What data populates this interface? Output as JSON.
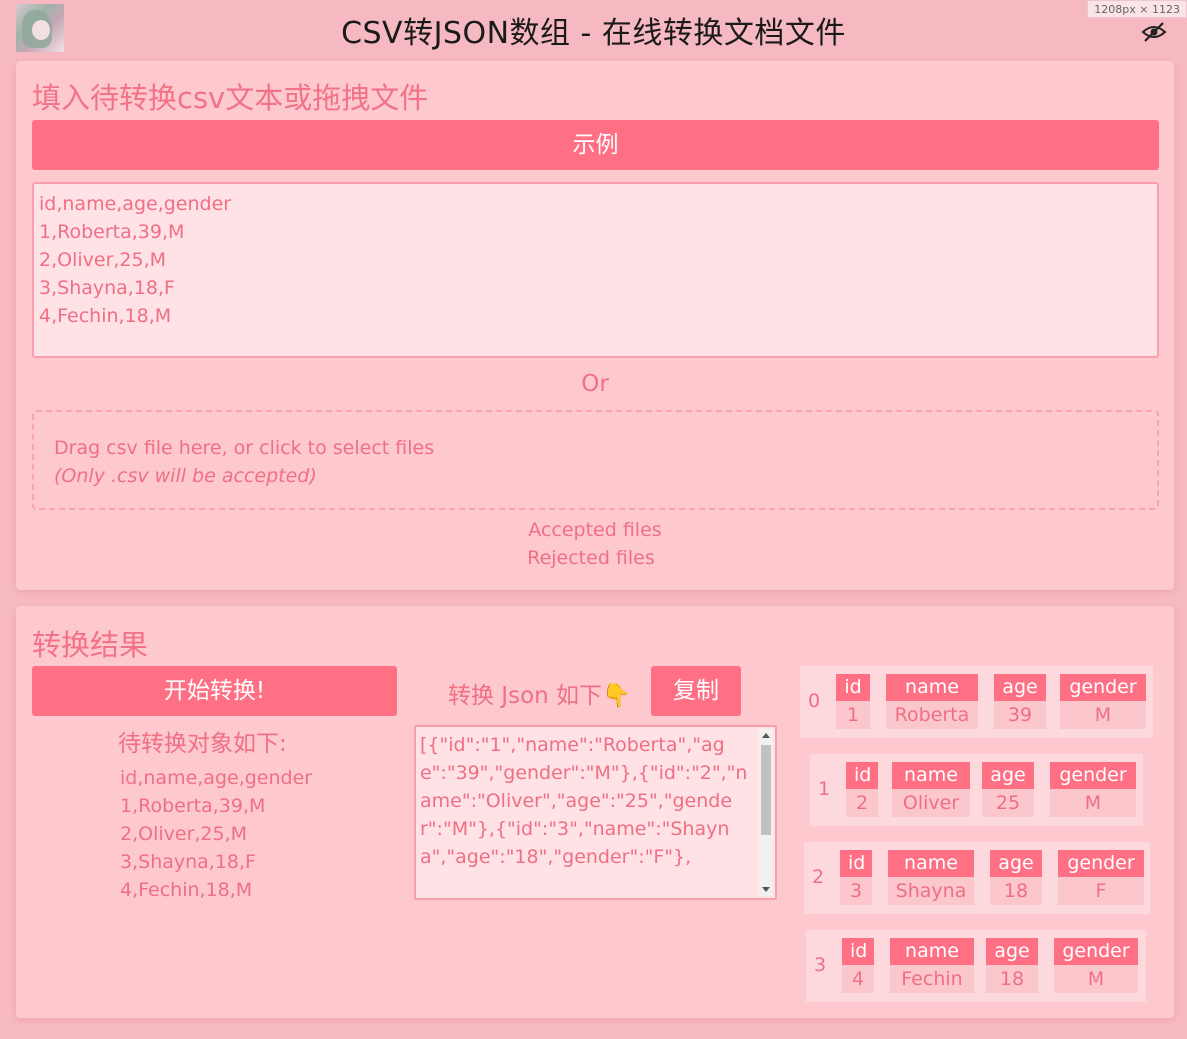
{
  "header": {
    "title": "CSV转JSON数组 - 在线转换文档文件",
    "size_badge": "1208px × 1123"
  },
  "input_card": {
    "title": "填入待转换csv文本或拖拽文件",
    "example_button": "示例",
    "csv_text": "id,name,age,gender\n1,Roberta,39,M\n2,Oliver,25,M\n3,Shayna,18,F\n4,Fechin,18,M",
    "or_text": "Or",
    "dropzone": {
      "text": "Drag csv file here, or click to select files",
      "hint": "(Only .csv will be accepted)"
    },
    "accepted_files": "Accepted files",
    "rejected_files": "Rejected files"
  },
  "result_card": {
    "title": "转换结果",
    "convert_button": "开始转换!",
    "pending_title": "待转换对象如下:",
    "pending_text": "id,name,age,gender\n1,Roberta,39,M\n2,Oliver,25,M\n3,Shayna,18,F\n4,Fechin,18,M",
    "json_label": "转换 Json 如下👇",
    "copy_button": "复制",
    "json_output": "[{\"id\":\"1\",\"name\":\"Roberta\",\"age\":\"39\",\"gender\":\"M\"},{\"id\":\"2\",\"name\":\"Oliver\",\"age\":\"25\",\"gender\":\"M\"},{\"id\":\"3\",\"name\":\"Shayna\",\"age\":\"18\",\"gender\":\"F\"},",
    "records": [
      {
        "index": "0",
        "id": "1",
        "name": "Roberta",
        "age": "39",
        "gender": "M"
      },
      {
        "index": "1",
        "id": "2",
        "name": "Oliver",
        "age": "25",
        "gender": "M"
      },
      {
        "index": "2",
        "id": "3",
        "name": "Shayna",
        "age": "18",
        "gender": "F"
      },
      {
        "index": "3",
        "id": "4",
        "name": "Fechin",
        "age": "18",
        "gender": "M"
      }
    ],
    "keys": {
      "id": "id",
      "name": "name",
      "age": "age",
      "gender": "gender"
    }
  },
  "colors": {
    "background": "#f6b9c1",
    "card": "#fdc9cf",
    "accent": "#ff7085",
    "text": "#ef6f84"
  }
}
